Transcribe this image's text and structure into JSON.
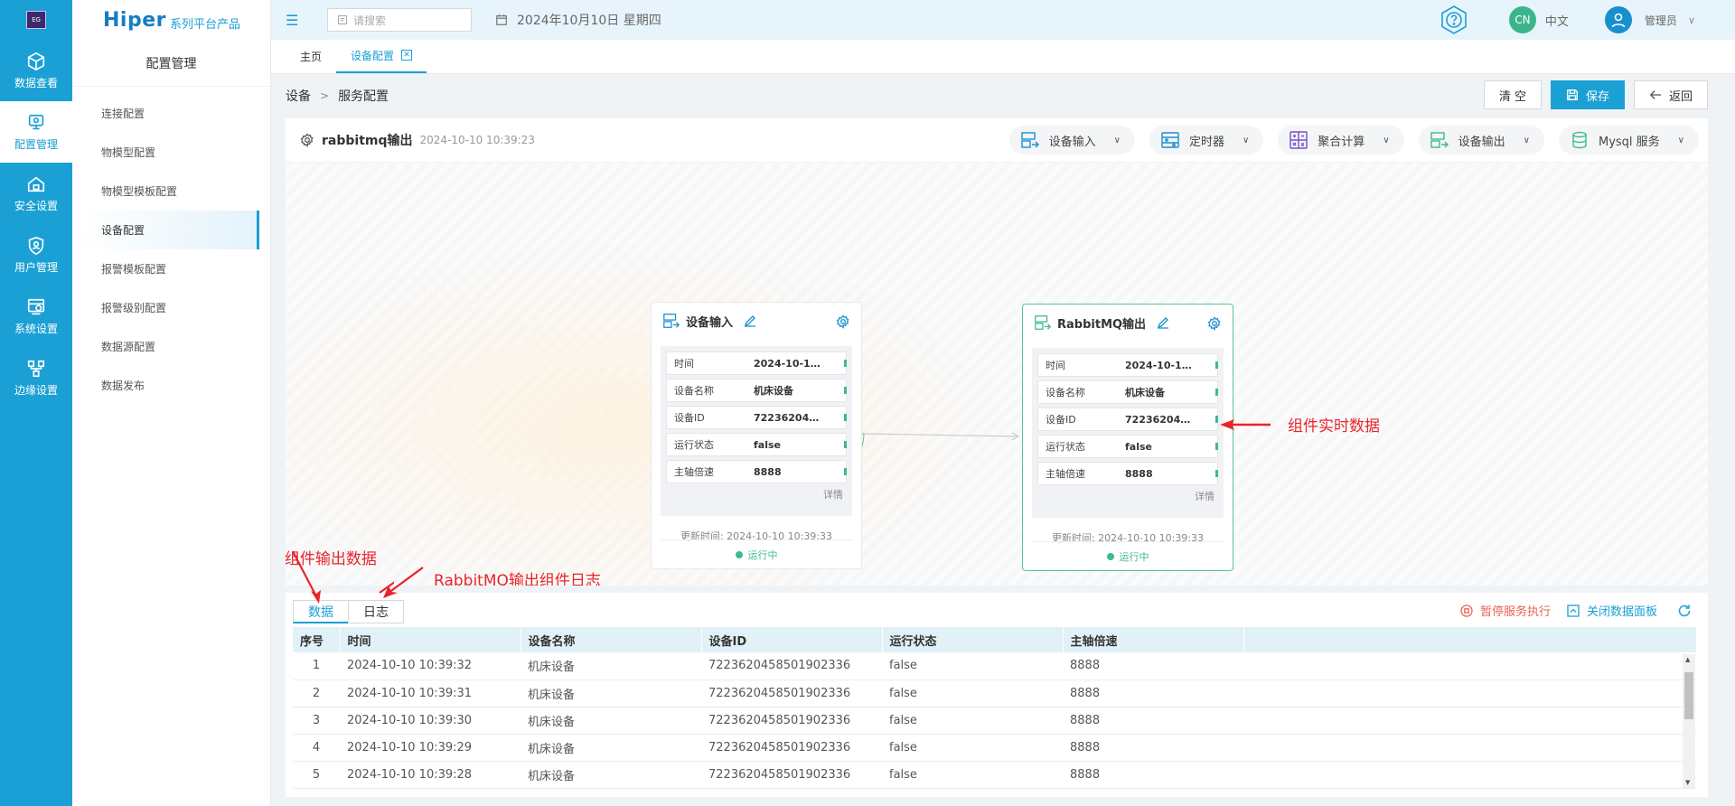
{
  "rail": {
    "logo_text": "EG",
    "items": [
      {
        "label": "数据查看",
        "icon": "cube-icon",
        "active": false
      },
      {
        "label": "配置管理",
        "icon": "config-icon",
        "active": true
      },
      {
        "label": "安全设置",
        "icon": "lock-house-icon",
        "active": false
      },
      {
        "label": "用户管理",
        "icon": "shield-user-icon",
        "active": false
      },
      {
        "label": "系统设置",
        "icon": "system-gear-icon",
        "active": false
      },
      {
        "label": "边缘设置",
        "icon": "edge-network-icon",
        "active": false
      }
    ]
  },
  "brand": {
    "main": "Hiper",
    "sub": "系列平台产品"
  },
  "sidebar": {
    "title": "配置管理",
    "items": [
      {
        "label": "连接配置"
      },
      {
        "label": "物模型配置"
      },
      {
        "label": "物模型模板配置"
      },
      {
        "label": "设备配置"
      },
      {
        "label": "报警模板配置"
      },
      {
        "label": "报警级别配置"
      },
      {
        "label": "数据源配置"
      },
      {
        "label": "数据发布"
      }
    ]
  },
  "topbar": {
    "search_placeholder": "请搜索",
    "date": "2024年10月10日 星期四",
    "lang_badge": "CN",
    "lang_label": "中文",
    "user_name": "管理员"
  },
  "tabs": [
    {
      "label": "主页"
    },
    {
      "label": "设备配置"
    }
  ],
  "breadcrumb": {
    "root": "设备",
    "current": "服务配置"
  },
  "actions": {
    "clear": "清 空",
    "save": "保存",
    "back": "返回"
  },
  "flow": {
    "name": "rabbitmq输出",
    "created": "2024-10-10 10:39:23",
    "tools": [
      {
        "label": "设备输入",
        "icon": "device-input-icon"
      },
      {
        "label": "定时器",
        "icon": "timer-icon"
      },
      {
        "label": "聚合计算",
        "icon": "calculator-icon"
      },
      {
        "label": "设备输出",
        "icon": "device-output-icon"
      },
      {
        "label": "Mysql 服务",
        "icon": "database-icon"
      }
    ]
  },
  "nodes": {
    "input": {
      "title": "设备输入",
      "fields": [
        {
          "k": "时间",
          "v": "2024-10-10..."
        },
        {
          "k": "设备名称",
          "v": "机床设备"
        },
        {
          "k": "设备ID",
          "v": "7223620458..."
        },
        {
          "k": "运行状态",
          "v": "false"
        },
        {
          "k": "主轴倍速",
          "v": "8888"
        }
      ],
      "detail": "详情",
      "updated": "更新时间: 2024-10-10 10:39:33",
      "status": "运行中"
    },
    "output": {
      "title": "RabbitMQ输出",
      "fields": [
        {
          "k": "时间",
          "v": "2024-10-10..."
        },
        {
          "k": "设备名称",
          "v": "机床设备"
        },
        {
          "k": "设备ID",
          "v": "7223620458..."
        },
        {
          "k": "运行状态",
          "v": "false"
        },
        {
          "k": "主轴倍速",
          "v": "8888"
        }
      ],
      "detail": "详情",
      "updated": "更新时间: 2024-10-10 10:39:33",
      "status": "运行中"
    }
  },
  "annotations": {
    "realtime": "组件实时数据",
    "output_data": "RabbitMQ输出组件输出数据",
    "output_log": "RabbitMQ输出组件日志"
  },
  "panel": {
    "tabs": [
      {
        "label": "数据"
      },
      {
        "label": "日志"
      }
    ],
    "pause": "暂停服务执行",
    "close": "关闭数据面板",
    "columns": [
      "序号",
      "时间",
      "设备名称",
      "设备ID",
      "运行状态",
      "主轴倍速"
    ],
    "rows": [
      [
        "1",
        "2024-10-10 10:39:32",
        "机床设备",
        "7223620458501902336",
        "false",
        "8888"
      ],
      [
        "2",
        "2024-10-10 10:39:31",
        "机床设备",
        "7223620458501902336",
        "false",
        "8888"
      ],
      [
        "3",
        "2024-10-10 10:39:30",
        "机床设备",
        "7223620458501902336",
        "false",
        "8888"
      ],
      [
        "4",
        "2024-10-10 10:39:29",
        "机床设备",
        "7223620458501902336",
        "false",
        "8888"
      ],
      [
        "5",
        "2024-10-10 10:39:28",
        "机床设备",
        "7223620458501902336",
        "false",
        "8888"
      ]
    ]
  },
  "colors": {
    "primary": "#1aa0d4",
    "success": "#3fb98e",
    "danger": "#e8242a"
  }
}
